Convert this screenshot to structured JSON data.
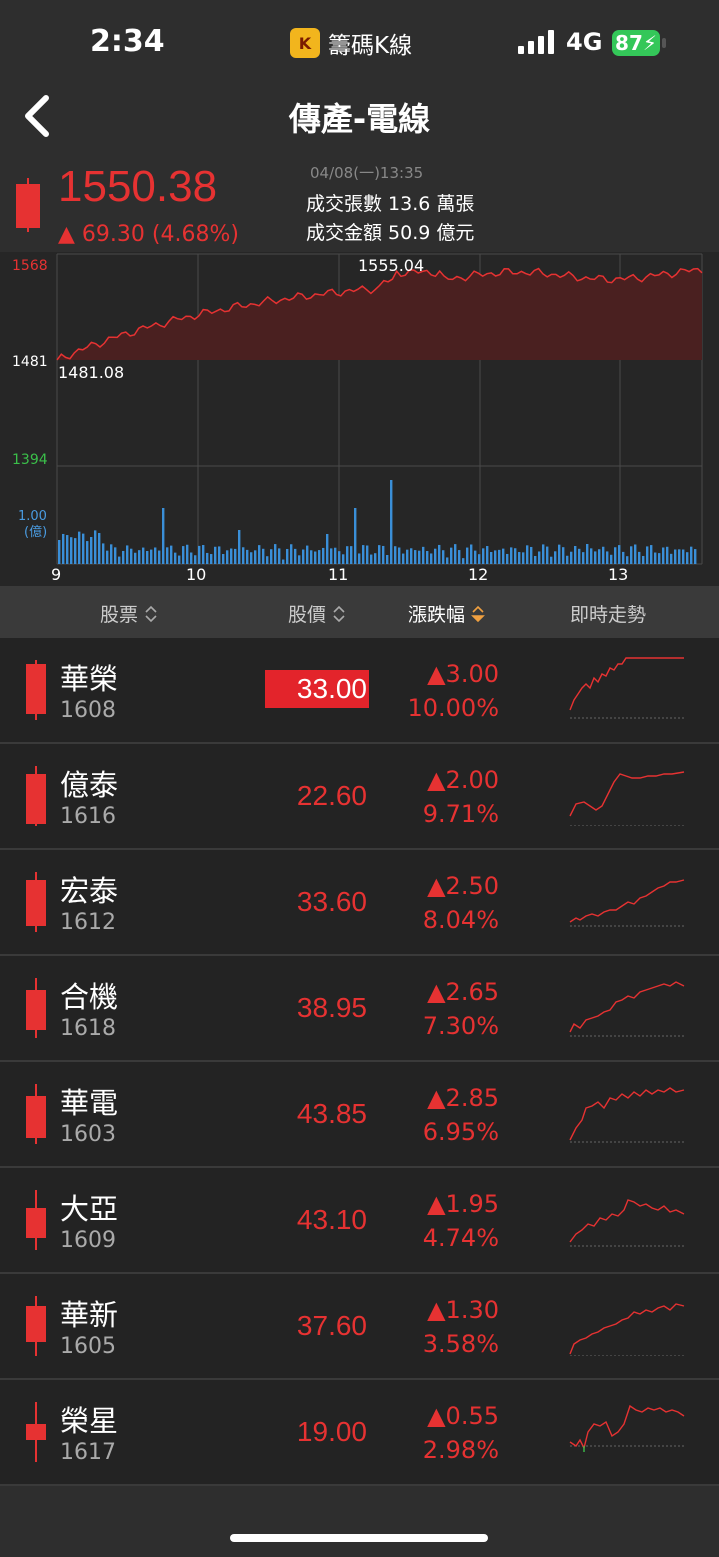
{
  "status_bar": {
    "time": "2:34",
    "app_name": "籌碼K線",
    "app_logo_text": "K",
    "network": "4G",
    "battery": "87"
  },
  "nav": {
    "title": "傳產-電線"
  },
  "summary": {
    "price": "1550.38",
    "change": "▲ 69.30 (4.68%)",
    "datetime": "04/08(一)13:35",
    "volume": "成交張數  13.6 萬張",
    "amount": "成交金額  50.9 億元"
  },
  "intraday": {
    "y_high_label": "1568",
    "y_ref_label": "1481",
    "y_low_label": "1394",
    "peak_label": "1555.04",
    "open_label": "1481.08",
    "vol_label_1": "1.00",
    "vol_label_2": "(億)",
    "x_labels": [
      "9",
      "10",
      "11",
      "12",
      "13"
    ],
    "colors": {
      "up": "#e63232",
      "fill": "#4a2020",
      "volume": "#3a8fd8",
      "low": "#3bbf4a"
    }
  },
  "table": {
    "headers": {
      "stock": "股票",
      "price": "股價",
      "change": "漲跌幅",
      "trend": "即時走勢"
    },
    "rows": [
      {
        "name": "華榮",
        "code": "1608",
        "price": "33.00",
        "change": "▲3.00",
        "pct": "10.00%"
      },
      {
        "name": "億泰",
        "code": "1616",
        "price": "22.60",
        "change": "▲2.00",
        "pct": "9.71%"
      },
      {
        "name": "宏泰",
        "code": "1612",
        "price": "33.60",
        "change": "▲2.50",
        "pct": "8.04%"
      },
      {
        "name": "合機",
        "code": "1618",
        "price": "38.95",
        "change": "▲2.65",
        "pct": "7.30%"
      },
      {
        "name": "華電",
        "code": "1603",
        "price": "43.85",
        "change": "▲2.85",
        "pct": "6.95%"
      },
      {
        "name": "大亞",
        "code": "1609",
        "price": "43.10",
        "change": "▲1.95",
        "pct": "4.74%"
      },
      {
        "name": "華新",
        "code": "1605",
        "price": "37.60",
        "change": "▲1.30",
        "pct": "3.58%"
      },
      {
        "name": "榮星",
        "code": "1617",
        "price": "19.00",
        "change": "▲0.55",
        "pct": "2.98%"
      }
    ]
  }
}
